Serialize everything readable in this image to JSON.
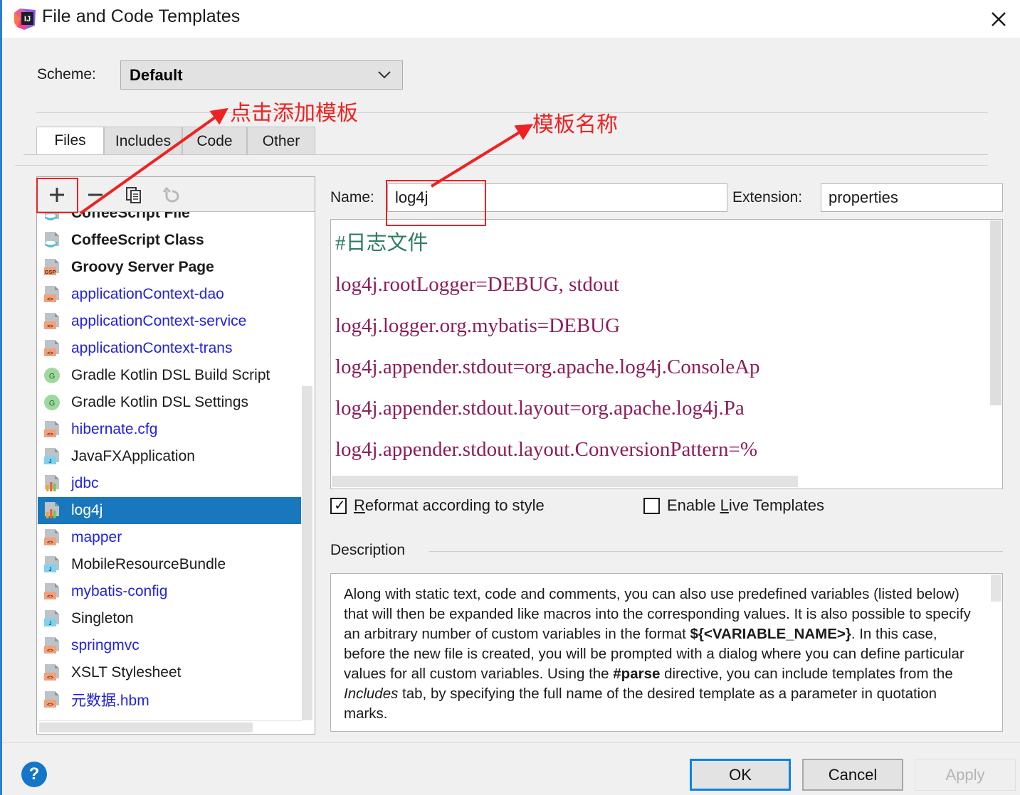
{
  "window": {
    "title": "File and Code Templates",
    "logo_icon": "intellij-idea-logo",
    "close_icon": "close-icon"
  },
  "scheme": {
    "label": "Scheme:",
    "value": "Default",
    "dropdown_icon": "chevron-down-icon"
  },
  "tabs": [
    {
      "label": "Files",
      "active": true
    },
    {
      "label": "Includes",
      "active": false
    },
    {
      "label": "Code",
      "active": false
    },
    {
      "label": "Other",
      "active": false
    }
  ],
  "list_toolbar": {
    "add_icon": "plus-icon",
    "remove_icon": "minus-icon",
    "copy_icon": "copy-icon",
    "undo_icon": "undo-icon"
  },
  "template_list": [
    {
      "label": "CoffeeScript File",
      "style": "bold",
      "icon": "coffeescript-file-icon",
      "clipped": true
    },
    {
      "label": "CoffeeScript Class",
      "style": "bold",
      "icon": "coffeescript-file-icon"
    },
    {
      "label": "Groovy Server Page",
      "style": "bold",
      "icon": "gsp-file-icon"
    },
    {
      "label": "applicationContext-dao",
      "style": "link",
      "icon": "xml-file-icon"
    },
    {
      "label": "applicationContext-service",
      "style": "link",
      "icon": "xml-file-icon"
    },
    {
      "label": "applicationContext-trans",
      "style": "link",
      "icon": "xml-file-icon"
    },
    {
      "label": "Gradle Kotlin DSL Build Script",
      "style": "normal",
      "icon": "gradle-icon"
    },
    {
      "label": "Gradle Kotlin DSL Settings",
      "style": "normal",
      "icon": "gradle-icon"
    },
    {
      "label": "hibernate.cfg",
      "style": "link",
      "icon": "xml-file-icon"
    },
    {
      "label": "JavaFXApplication",
      "style": "normal",
      "icon": "java-file-icon"
    },
    {
      "label": "jdbc",
      "style": "link",
      "icon": "properties-file-icon"
    },
    {
      "label": "log4j",
      "style": "selected",
      "icon": "properties-file-icon"
    },
    {
      "label": "mapper",
      "style": "link",
      "icon": "xml-file-icon"
    },
    {
      "label": "MobileResourceBundle",
      "style": "normal",
      "icon": "java-file-icon"
    },
    {
      "label": "mybatis-config",
      "style": "link",
      "icon": "xml-file-icon"
    },
    {
      "label": "Singleton",
      "style": "normal",
      "icon": "java-file-icon"
    },
    {
      "label": "springmvc",
      "style": "link",
      "icon": "xml-file-icon"
    },
    {
      "label": "XSLT Stylesheet",
      "style": "normal",
      "icon": "xml-file-icon"
    },
    {
      "label": "元数据.hbm",
      "style": "link",
      "icon": "xml-file-icon"
    }
  ],
  "name_field": {
    "label": "Name:",
    "value": "log4j"
  },
  "extension_field": {
    "label": "Extension:",
    "value": "properties"
  },
  "editor": {
    "lines": [
      {
        "text": "#日志文件",
        "kind": "comment"
      },
      {
        "text": "log4j.rootLogger=DEBUG, stdout",
        "kind": "property"
      },
      {
        "text": "log4j.logger.org.mybatis=DEBUG",
        "kind": "property"
      },
      {
        "text": "log4j.appender.stdout=org.apache.log4j.ConsoleAp",
        "kind": "property"
      },
      {
        "text": "log4j.appender.stdout.layout=org.apache.log4j.Pa",
        "kind": "property"
      },
      {
        "text": "log4j.appender.stdout.layout.ConversionPattern=%",
        "kind": "property"
      }
    ]
  },
  "options": {
    "reformat": {
      "label_prefix": "",
      "mnemonic": "R",
      "label_suffix": "eformat according to style",
      "checked": true,
      "check_glyph": "✓"
    },
    "live_templates": {
      "label_prefix": "Enable ",
      "mnemonic": "L",
      "label_suffix": "ive Templates",
      "checked": false
    }
  },
  "description": {
    "title": "Description",
    "p1": "Along with static text, code and comments, you can also use predefined variables (listed below) that will then be expanded like macros into the corresponding values. It is also possible to specify an arbitrary number of custom variables in the format ",
    "var": "${<VARIABLE_NAME>}",
    "p2": ". In this case, before the new file is created, you will be prompted with a dialog where you can define particular values for all custom variables. Using the ",
    "parse": "#parse",
    "p3": " directive, you can include templates from the ",
    "includes": "Includes",
    "p4": " tab, by specifying the full name of the desired template as a parameter in quotation marks."
  },
  "footer": {
    "help_icon": "help-question-icon",
    "help_label": "?",
    "ok": "OK",
    "cancel": "Cancel",
    "apply": "Apply"
  },
  "annotations": {
    "add_template": "点击添加模板",
    "template_name": "模板名称"
  },
  "colors": {
    "selection_blue": "#1978bd",
    "annotation_red": "#ee2222",
    "focus_blue": "#0a84e0",
    "link_blue": "#2222dd",
    "comment_green": "#2e7d62",
    "code_magenta": "#8c1d58"
  }
}
